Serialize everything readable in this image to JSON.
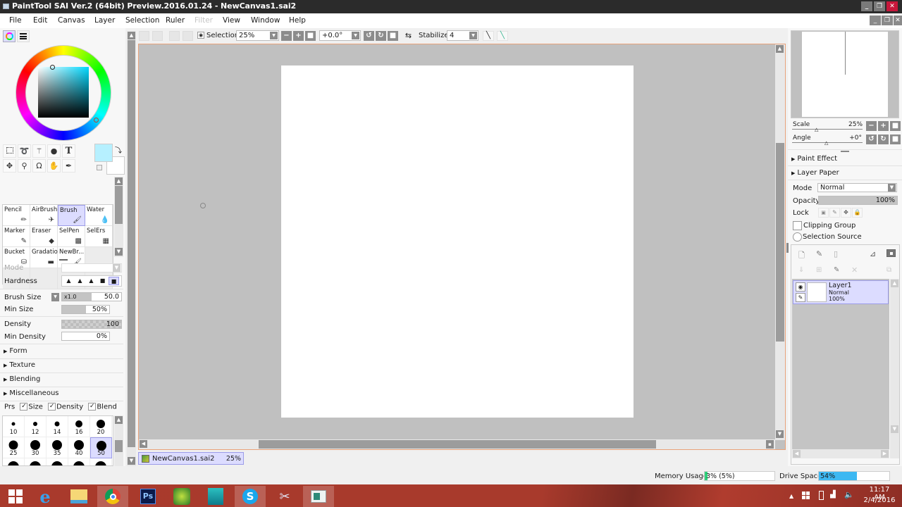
{
  "window": {
    "title": "PaintTool SAI Ver.2 (64bit) Preview.2016.01.24 - NewCanvas1.sai2",
    "minimize_icon": "minimize-icon",
    "restore_icon": "restore-icon",
    "close_icon": "close-icon"
  },
  "menu": {
    "items": [
      {
        "label": "File",
        "enabled": true
      },
      {
        "label": "Edit",
        "enabled": true
      },
      {
        "label": "Canvas",
        "enabled": true
      },
      {
        "label": "Layer",
        "enabled": true
      },
      {
        "label": "Selection",
        "enabled": true
      },
      {
        "label": "Ruler",
        "enabled": true
      },
      {
        "label": "Filter",
        "enabled": false
      },
      {
        "label": "View",
        "enabled": true
      },
      {
        "label": "Window",
        "enabled": true
      },
      {
        "label": "Help",
        "enabled": true
      }
    ]
  },
  "toolbar": {
    "selection_toggle_label": "Selection",
    "zoom_value": "25%",
    "rotation_value": "+0.0°",
    "stabilizer_label": "Stabilizer",
    "stabilizer_value": "4"
  },
  "color_panel": {
    "current_color": "#b6f0ff",
    "background_color": "#ffffff",
    "hue_marker": "cyan"
  },
  "tools": {
    "icons": [
      "rect-select-icon",
      "lasso-icon",
      "magic-wand-icon",
      "shape-icon",
      "text-icon",
      "move-icon",
      "zoom-icon",
      "rotate-icon",
      "hand-icon",
      "eyedropper-icon"
    ],
    "text_tool_glyph": "T"
  },
  "brushes": [
    {
      "label": "Pencil",
      "icon": "pencil-icon",
      "selected": false
    },
    {
      "label": "AirBrush",
      "icon": "airbrush-icon",
      "selected": false
    },
    {
      "label": "Brush",
      "icon": "brush-icon",
      "selected": true
    },
    {
      "label": "Water",
      "icon": "water-icon",
      "selected": false
    },
    {
      "label": "Marker",
      "icon": "marker-icon",
      "selected": false
    },
    {
      "label": "Eraser",
      "icon": "eraser-icon",
      "selected": false
    },
    {
      "label": "SelPen",
      "icon": "selpen-icon",
      "selected": false
    },
    {
      "label": "SelErs",
      "icon": "selers-icon",
      "selected": false
    },
    {
      "label": "Bucket",
      "icon": "bucket-icon",
      "selected": false
    },
    {
      "label": "Gradation",
      "icon": "gradation-icon",
      "selected": false
    },
    {
      "label": "NewBr...",
      "icon": "brush-icon",
      "selected": false
    }
  ],
  "brush_settings": {
    "mode_label": "Mode",
    "hardness_label": "Hardness",
    "hardness_selected_index": 4,
    "brush_size_label": "Brush Size",
    "brush_size_multiplier": "x1.0",
    "brush_size_value": "50.0",
    "min_size_label": "Min Size",
    "min_size_value": "50%",
    "min_size_fraction": 0.5,
    "density_label": "Density",
    "density_value": "100",
    "min_density_label": "Min Density",
    "min_density_value": "0%",
    "sections": [
      "Form",
      "Texture",
      "Blending",
      "Miscellaneous"
    ],
    "pressure_label": "Prs",
    "pressure_options": [
      {
        "label": "Size",
        "checked": true
      },
      {
        "label": "Density",
        "checked": true
      },
      {
        "label": "Blend",
        "checked": true
      }
    ],
    "size_presets": [
      {
        "value": "10",
        "selected": false
      },
      {
        "value": "12",
        "selected": false
      },
      {
        "value": "14",
        "selected": false
      },
      {
        "value": "16",
        "selected": false
      },
      {
        "value": "20",
        "selected": false
      },
      {
        "value": "25",
        "selected": false
      },
      {
        "value": "30",
        "selected": false
      },
      {
        "value": "35",
        "selected": false
      },
      {
        "value": "40",
        "selected": false
      },
      {
        "value": "50",
        "selected": true
      }
    ]
  },
  "canvas": {
    "document_tab_name": "NewCanvas1.sai2",
    "document_tab_zoom": "25%"
  },
  "navigator": {
    "scale_label": "Scale",
    "scale_value": "25%",
    "angle_label": "Angle",
    "angle_value": "+0°"
  },
  "layer_panel": {
    "sections": [
      "Paint Effect",
      "Layer Paper"
    ],
    "mode_label": "Mode",
    "mode_value": "Normal",
    "opacity_label": "Opacity",
    "opacity_value": "100%",
    "lock_label": "Lock",
    "clipping_group_label": "Clipping Group",
    "selection_source_label": "Selection Source",
    "layers": [
      {
        "name": "Layer1",
        "mode": "Normal",
        "opacity": "100%",
        "visible": true,
        "selected": true
      }
    ]
  },
  "status": {
    "memory_label": "Memory Usage",
    "memory_value": "3% (5%)",
    "memory_fraction": 0.03,
    "drive_label": "Drive Space",
    "drive_value": "54%",
    "drive_fraction": 0.54
  },
  "taskbar": {
    "apps": [
      "start-icon",
      "internet-explorer-icon",
      "file-explorer-icon",
      "chrome-icon",
      "photoshop-icon",
      "paint-app-icon",
      "maya-icon",
      "skype-icon",
      "snipping-tool-icon",
      "painttool-sai-icon"
    ],
    "time": "11:17 AM",
    "date": "2/4/2016"
  }
}
